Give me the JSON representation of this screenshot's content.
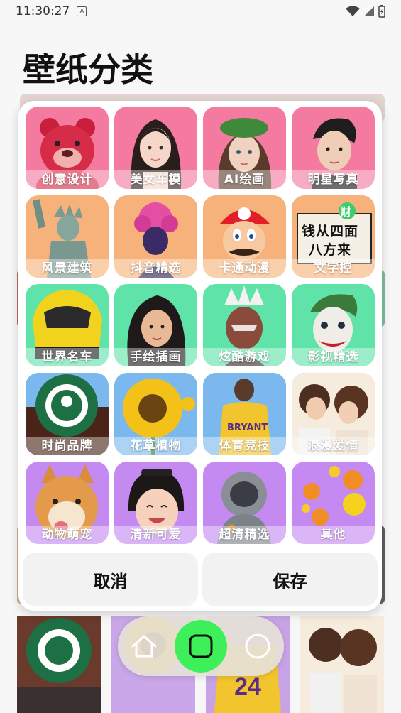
{
  "status": {
    "time": "11:30:27"
  },
  "header": {
    "title": "壁纸分类"
  },
  "categories": [
    {
      "label": "创意设计",
      "bg": "#f47aa0"
    },
    {
      "label": "美女车模",
      "bg": "#f47aa0"
    },
    {
      "label": "AI绘画",
      "bg": "#f47aa0"
    },
    {
      "label": "明星写真",
      "bg": "#f47aa0"
    },
    {
      "label": "风景建筑",
      "bg": "#f6b27a"
    },
    {
      "label": "抖音精选",
      "bg": "#f6b27a"
    },
    {
      "label": "卡通动漫",
      "bg": "#f6b27a"
    },
    {
      "label": "文字控",
      "bg": "#f6b27a"
    },
    {
      "label": "世界名车",
      "bg": "#5fe3a8"
    },
    {
      "label": "手绘插画",
      "bg": "#5fe3a8"
    },
    {
      "label": "炫酷游戏",
      "bg": "#5fe3a8"
    },
    {
      "label": "影视精选",
      "bg": "#5fe3a8"
    },
    {
      "label": "时尚品牌",
      "bg": "#7ab8ee"
    },
    {
      "label": "花草植物",
      "bg": "#7ab8ee"
    },
    {
      "label": "体育竞技",
      "bg": "#7ab8ee"
    },
    {
      "label": "浪漫爱情",
      "bg": "#7ab8ee"
    },
    {
      "label": "动物萌宠",
      "bg": "#c58af2"
    },
    {
      "label": "清新可爱",
      "bg": "#c58af2"
    },
    {
      "label": "超清精选",
      "bg": "#c58af2"
    },
    {
      "label": "其他",
      "bg": "#c58af2"
    }
  ],
  "tile_texts": {
    "wealth_sign": "财",
    "slogan_line1": "钱从四面",
    "slogan_line2": "八方来",
    "jersey": "BRYANT"
  },
  "dialog": {
    "cancel_label": "取消",
    "save_label": "保存"
  },
  "nav_icons": [
    "home-outline-icon",
    "app-switch-icon",
    "circle-icon"
  ]
}
